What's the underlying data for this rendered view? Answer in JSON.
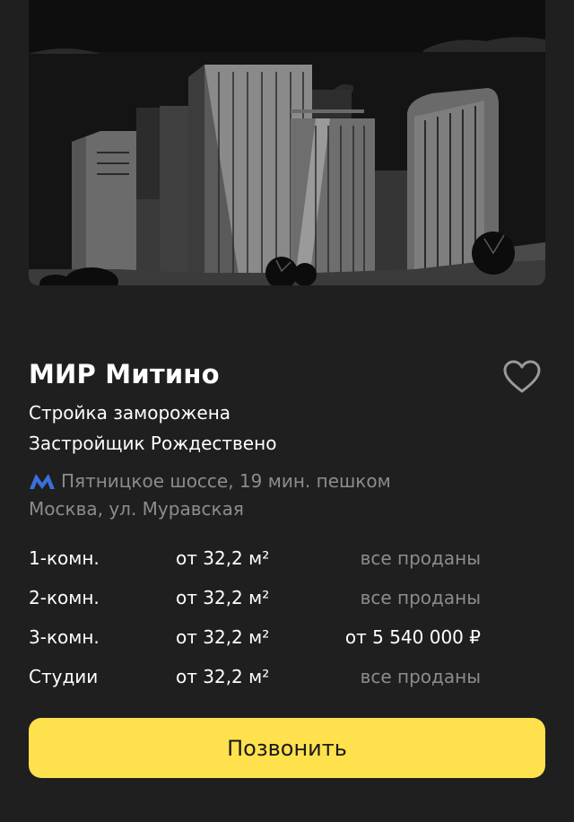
{
  "complex": {
    "title": "МИР Митино",
    "status": "Стройка заморожена",
    "developer": "Застройщик Рождествено",
    "metro": {
      "icon": "metro-m-icon",
      "color": "#3b6fd9",
      "text": "Пятницкое шоссе, 19 мин. пешком"
    },
    "address": "Москва, ул. Муравская"
  },
  "apartments": [
    {
      "type": "1-комн.",
      "area": "от 32,2 м²",
      "price": "все проданы",
      "available": false
    },
    {
      "type": "2-комн.",
      "area": "от 32,2 м²",
      "price": "все проданы",
      "available": false
    },
    {
      "type": "3-комн.",
      "area": "от 32,2 м²",
      "price": "от 5 540 000 ₽",
      "available": true
    },
    {
      "type": "Студии",
      "area": "от 32,2 м²",
      "price": "все проданы",
      "available": false
    }
  ],
  "actions": {
    "call_label": "Позвонить",
    "favorite_icon": "heart-outline-icon"
  },
  "colors": {
    "background": "#1f1f1f",
    "accent": "#ffe14d",
    "muted_text": "#8c8c8c"
  }
}
